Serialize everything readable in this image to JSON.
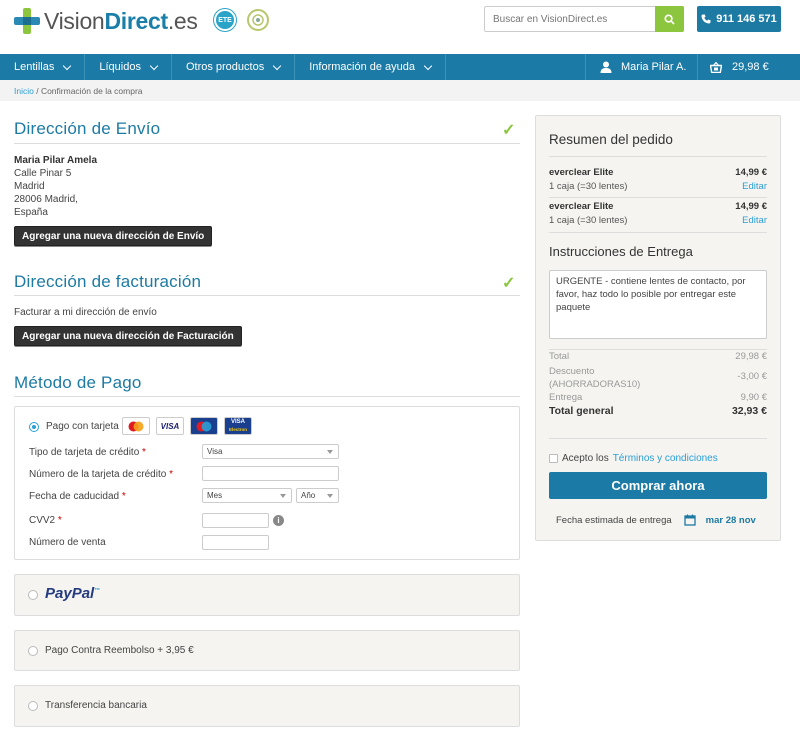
{
  "header": {
    "logo_prefix": "Vision",
    "logo_bold": "Direct",
    "logo_suffix": ".es",
    "badge1": "ETE",
    "search_placeholder": "Buscar en VisionDirect.es",
    "phone": "911 146 571"
  },
  "nav": {
    "items": [
      {
        "label": "Lentillas"
      },
      {
        "label": "Líquidos"
      },
      {
        "label": "Otros productos"
      },
      {
        "label": "Información de ayuda"
      }
    ],
    "user": "Maria Pilar A.",
    "cart_total": "29,98 €"
  },
  "breadcrumb": {
    "home": "Inicio",
    "separator": " / ",
    "current": "Confirmación de la compra"
  },
  "shipping": {
    "title": "Dirección de Envío",
    "name": "Maria Pilar Amela",
    "line1": "Calle Pinar 5",
    "line2": "Madrid",
    "line3": "28006 Madrid,",
    "line4": "España",
    "add_button": "Agregar una nueva dirección de Envío"
  },
  "billing": {
    "title": "Dirección de facturación",
    "note": "Facturar a mi dirección de envío",
    "add_button": "Agregar una nueva dirección de Facturación"
  },
  "payment": {
    "title": "Método de Pago",
    "card_option": "Pago con tarjeta",
    "cards": [
      "VISA",
      "VISA"
    ],
    "card_type_label": "Tipo de tarjeta de crédito",
    "card_type_value": "Visa",
    "card_number_label": "Número de la tarjeta de crédito",
    "expiry_label": "Fecha de caducidad",
    "month_placeholder": "Mes",
    "year_placeholder": "Año",
    "cvv_label": "CVV2",
    "sale_number_label": "Número de venta",
    "required_mark": "*",
    "paypal": "PayPal",
    "paypal_tm": "™",
    "cod": "Pago Contra Reembolso + 3,95 €",
    "transfer": "Transferencia bancaria"
  },
  "summary": {
    "title": "Resumen del pedido",
    "items": [
      {
        "name": "everclear Elite",
        "price": "14,99 €",
        "qty": "1 caja (=30 lentes)",
        "edit": "Editar"
      },
      {
        "name": "everclear Elite",
        "price": "14,99 €",
        "qty": "1 caja (=30 lentes)",
        "edit": "Editar"
      }
    ],
    "delivery_title": "Instrucciones de Entrega",
    "delivery_notes": "URGENTE - contiene lentes de contacto, por favor, haz todo lo posible por entregar este paquete",
    "total_label": "Total",
    "total_value": "29,98 €",
    "discount_label": "Descuento",
    "discount_code": "(AHORRADORAS10)",
    "discount_value": "-3,00 €",
    "shipping_label": "Entrega",
    "shipping_value": "9,90 €",
    "grand_label": "Total general",
    "grand_value": "32,93 €",
    "terms_prefix": "Acepto los",
    "terms_link": "Términos y condiciones",
    "buy_button": "Comprar ahora",
    "est_label": "Fecha estimada de entrega",
    "est_date": "mar 28 nov"
  }
}
